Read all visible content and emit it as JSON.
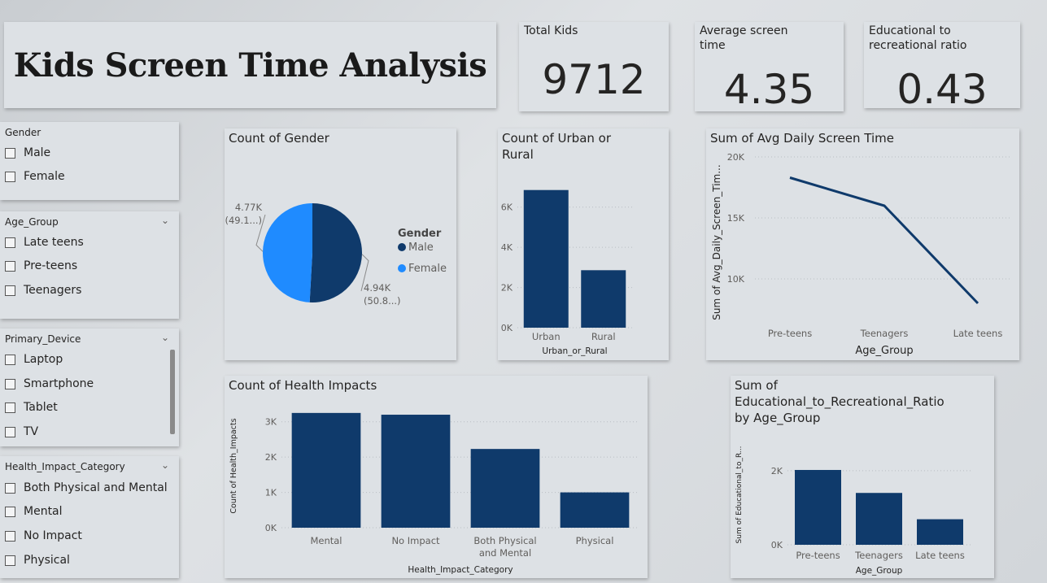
{
  "report_title": "Kids Screen Time Analysis",
  "kpis": {
    "total_kids": {
      "label": "Total Kids",
      "value": "9712"
    },
    "avg_screen_time": {
      "label": "Average screen time",
      "value": "4.35"
    },
    "edu_rec_ratio": {
      "label": "Educational to recreational ratio",
      "value": "0.43"
    }
  },
  "slicers": {
    "gender": {
      "title": "Gender",
      "items": [
        "Male",
        "Female"
      ]
    },
    "age_group": {
      "title": "Age_Group",
      "items": [
        "Late teens",
        "Pre-teens",
        "Teenagers"
      ]
    },
    "primary_device": {
      "title": "Primary_Device",
      "items": [
        "Laptop",
        "Smartphone",
        "Tablet",
        "TV"
      ]
    },
    "health_impact": {
      "title": "Health_Impact_Category",
      "items": [
        "Both Physical and Mental",
        "Mental",
        "No Impact",
        "Physical"
      ]
    }
  },
  "colors": {
    "navy": "#0f3a6b",
    "blue": "#1f8bff",
    "grid": "#b9bec3"
  },
  "chart_data": [
    {
      "type": "pie",
      "title": "Count of Gender",
      "legend_title": "Gender",
      "legend_position": "right",
      "slices": [
        {
          "name": "Male",
          "value": 4940,
          "label_value": "4.94K",
          "label_pct": "(50.8...)",
          "color": "#0f3a6b"
        },
        {
          "name": "Female",
          "value": 4770,
          "label_value": "4.77K",
          "label_pct": "(49.1...)",
          "color": "#1f8bff"
        }
      ]
    },
    {
      "type": "bar",
      "title": "Count of Urban or Rural",
      "categories": [
        "Urban",
        "Rural"
      ],
      "values": [
        6850,
        2860
      ],
      "xlabel": "Urban_or_Rural",
      "ylabel": "",
      "ylim": [
        0,
        7000
      ],
      "yticks": [
        0,
        2000,
        4000,
        6000
      ],
      "ytick_labels": [
        "0K",
        "2K",
        "4K",
        "6K"
      ]
    },
    {
      "type": "line",
      "title": "Sum of Avg Daily Screen Time",
      "categories": [
        "Pre-teens",
        "Teenagers",
        "Late teens"
      ],
      "values": [
        18300,
        16000,
        8000
      ],
      "xlabel": "Age_Group",
      "ylabel": "Sum of Avg_Daily_Screen_Tim...",
      "ylim": [
        6000,
        20000
      ],
      "yticks": [
        10000,
        15000,
        20000
      ],
      "ytick_labels": [
        "10K",
        "15K",
        "20K"
      ]
    },
    {
      "type": "bar",
      "title": "Count of Health Impacts",
      "categories": [
        "Mental",
        "No Impact",
        "Both Physical and Mental",
        "Physical"
      ],
      "category_lines": [
        [
          "Mental"
        ],
        [
          "No Impact"
        ],
        [
          "Both Physical",
          "and Mental"
        ],
        [
          "Physical"
        ]
      ],
      "values": [
        3250,
        3200,
        2230,
        1000
      ],
      "xlabel": "Health_Impact_Category",
      "ylabel": "Count of Health_Impacts",
      "ylim": [
        0,
        3500
      ],
      "yticks": [
        0,
        1000,
        2000,
        3000
      ],
      "ytick_labels": [
        "0K",
        "1K",
        "2K",
        "3K"
      ]
    },
    {
      "type": "bar",
      "title": "Sum of Educational_to_Recreational_Ratio by Age_Group",
      "title_lines": [
        "Sum of",
        "Educational_to_Recreational_Ratio",
        "by Age_Group"
      ],
      "categories": [
        "Pre-teens",
        "Teenagers",
        "Late teens"
      ],
      "values": [
        2020,
        1400,
        690
      ],
      "xlabel": "Age_Group",
      "ylabel": "Sum of Educational_to_R...",
      "ylim": [
        0,
        2700
      ],
      "yticks": [
        0,
        2000
      ],
      "ytick_labels": [
        "0K",
        "2K"
      ]
    }
  ]
}
